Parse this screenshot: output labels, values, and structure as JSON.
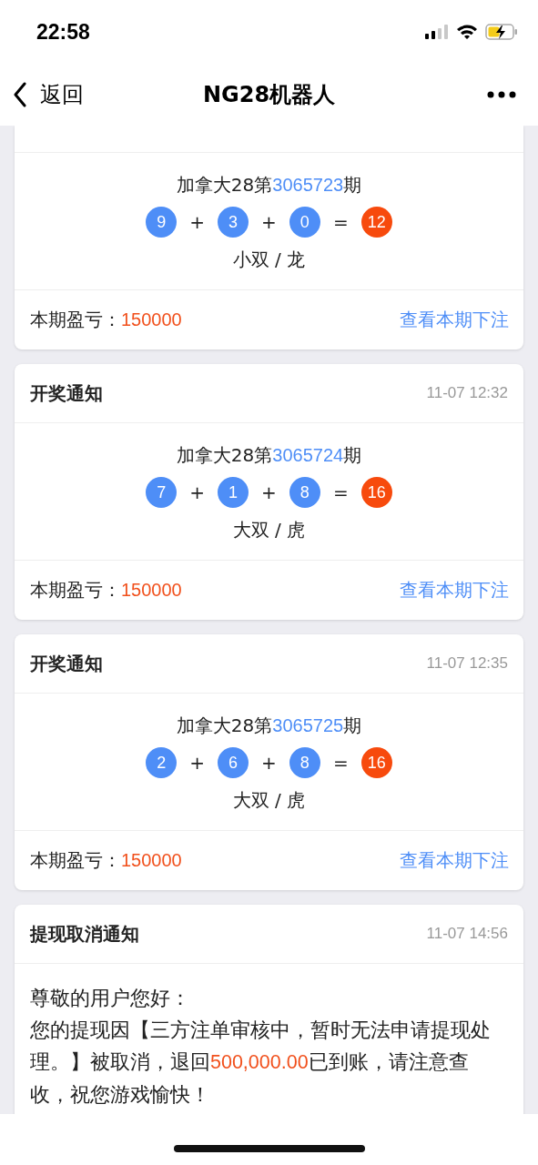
{
  "status_bar": {
    "time": "22:58"
  },
  "nav": {
    "back": "返回",
    "title": "NG28机器人"
  },
  "cards": [
    {
      "kind": "draw",
      "issue": {
        "before": "加拿大28第",
        "number": "3065723",
        "after": "期"
      },
      "equation": [
        {
          "kind": "ball",
          "text": "9"
        },
        {
          "kind": "op",
          "text": "+"
        },
        {
          "kind": "ball",
          "text": "3"
        },
        {
          "kind": "op",
          "text": "+"
        },
        {
          "kind": "ball",
          "text": "0"
        },
        {
          "kind": "op",
          "text": "="
        },
        {
          "kind": "sum",
          "text": "12"
        }
      ],
      "result": "小双 / 龙",
      "profit_label": "本期盈亏：",
      "profit": "150000",
      "link": "查看本期下注"
    },
    {
      "kind": "draw",
      "title": "开奖通知",
      "time": "11-07 12:32",
      "issue": {
        "before": "加拿大28第",
        "number": "3065724",
        "after": "期"
      },
      "equation": [
        {
          "kind": "ball",
          "text": "7"
        },
        {
          "kind": "op",
          "text": "+"
        },
        {
          "kind": "ball",
          "text": "1"
        },
        {
          "kind": "op",
          "text": "+"
        },
        {
          "kind": "ball",
          "text": "8"
        },
        {
          "kind": "op",
          "text": "="
        },
        {
          "kind": "sum",
          "text": "16"
        }
      ],
      "result": "大双 / 虎",
      "profit_label": "本期盈亏：",
      "profit": "150000",
      "link": "查看本期下注"
    },
    {
      "kind": "draw",
      "title": "开奖通知",
      "time": "11-07 12:35",
      "issue": {
        "before": "加拿大28第",
        "number": "3065725",
        "after": "期"
      },
      "equation": [
        {
          "kind": "ball",
          "text": "2"
        },
        {
          "kind": "op",
          "text": "+"
        },
        {
          "kind": "ball",
          "text": "6"
        },
        {
          "kind": "op",
          "text": "+"
        },
        {
          "kind": "ball",
          "text": "8"
        },
        {
          "kind": "op",
          "text": "="
        },
        {
          "kind": "sum",
          "text": "16"
        }
      ],
      "result": "大双 / 虎",
      "profit_label": "本期盈亏：",
      "profit": "150000",
      "link": "查看本期下注"
    },
    {
      "kind": "notice",
      "title": "提现取消通知",
      "time": "11-07 14:56",
      "greeting": "尊敬的用户您好：",
      "message": {
        "before": "您的提现因【三方注单审核中，暂时无法申请提现处理。】被取消，退回",
        "amount": "500,000.00",
        "after": "已到账，请注意查收，祝您游戏愉快！"
      }
    }
  ]
}
